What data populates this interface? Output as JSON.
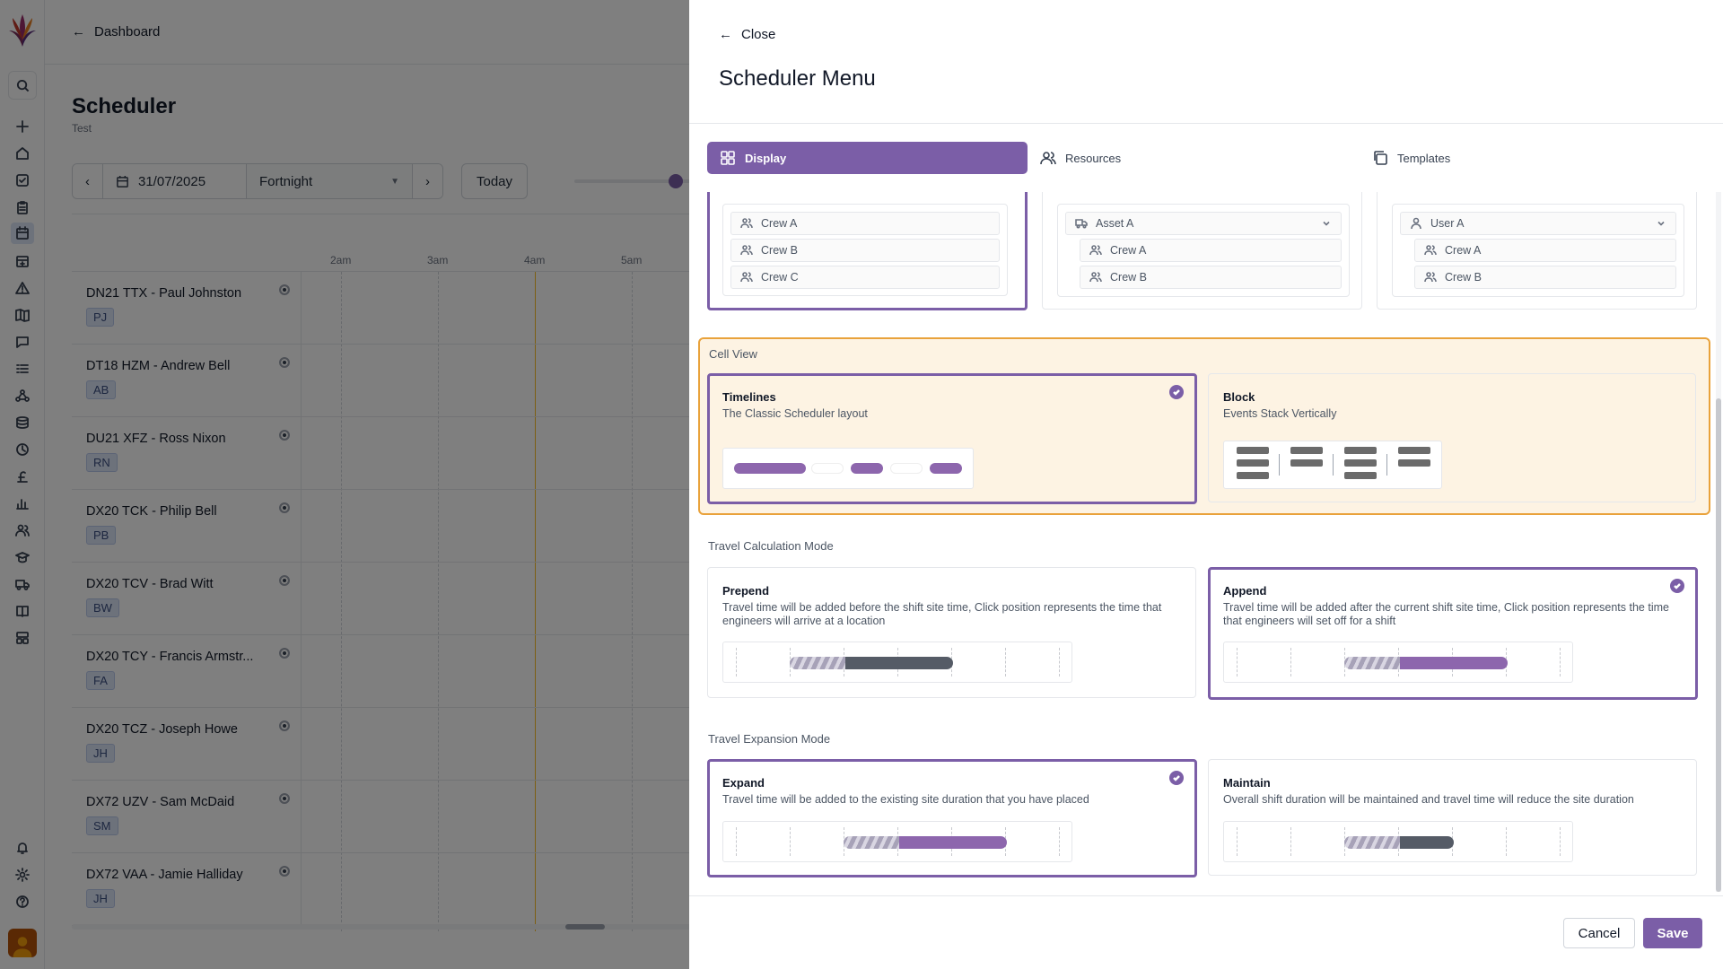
{
  "nav": {
    "icons": [
      "plus-icon",
      "home-icon",
      "check-square-icon",
      "clipboard-icon",
      "calendar-icon",
      "calendar-plus-icon",
      "alert-icon",
      "map-icon",
      "chat-icon",
      "list-icon",
      "network-icon",
      "database-icon",
      "clock-icon",
      "pound-icon",
      "bar-chart-icon",
      "users-icon",
      "graduation-icon",
      "truck-icon",
      "book-icon",
      "layout-icon"
    ],
    "bottom_icons": [
      "bell-icon",
      "gear-icon",
      "help-icon"
    ]
  },
  "background": {
    "back_label": "Dashboard",
    "page_title": "Scheduler",
    "page_subtitle": "Test",
    "date": "31/07/2025",
    "view_mode": "Fortnight",
    "today_label": "Today",
    "hours": [
      "2am",
      "3am",
      "4am",
      "5am"
    ],
    "resources": [
      {
        "name": "DN21 TTX - Paul Johnston",
        "initials": "PJ"
      },
      {
        "name": "DT18 HZM - Andrew Bell",
        "initials": "AB"
      },
      {
        "name": "DU21 XFZ - Ross Nixon",
        "initials": "RN"
      },
      {
        "name": "DX20 TCK - Philip Bell",
        "initials": "PB"
      },
      {
        "name": "DX20 TCV - Brad Witt",
        "initials": "BW"
      },
      {
        "name": "DX20 TCY - Francis Armstr...",
        "initials": "FA"
      },
      {
        "name": "DX20 TCZ - Joseph Howe",
        "initials": "JH"
      },
      {
        "name": "DX72 UZV - Sam McDaid",
        "initials": "SM"
      },
      {
        "name": "DX72 VAA - Jamie Halliday",
        "initials": "JH"
      }
    ]
  },
  "drawer": {
    "close_label": "Close",
    "title": "Scheduler Menu",
    "tabs": [
      {
        "label": "Display",
        "active": true
      },
      {
        "label": "Resources",
        "active": false
      },
      {
        "label": "Templates",
        "active": false
      }
    ],
    "group_previews": {
      "col1": [
        "Crew A",
        "Crew B",
        "Crew C"
      ],
      "col2_header": "Asset A",
      "col2": [
        "Crew A",
        "Crew B"
      ],
      "col3_header": "User A",
      "col3": [
        "Crew A",
        "Crew B"
      ]
    },
    "cell_view": {
      "title": "Cell View",
      "options": [
        {
          "title": "Timelines",
          "desc": "The Classic Scheduler layout",
          "selected": true
        },
        {
          "title": "Block",
          "desc": "Events Stack Vertically",
          "selected": false
        }
      ]
    },
    "travel_calc": {
      "title": "Travel Calculation Mode",
      "options": [
        {
          "title": "Prepend",
          "desc": "Travel time will be added before the shift site time, Click position represents the time that engineers will arrive at a location",
          "selected": false
        },
        {
          "title": "Append",
          "desc": "Travel time will be added after the current shift site time, Click position represents the time that engineers will set off for a shift",
          "selected": true
        }
      ]
    },
    "travel_expansion": {
      "title": "Travel Expansion Mode",
      "options": [
        {
          "title": "Expand",
          "desc": "Travel time will be added to the existing site duration that you have placed",
          "selected": true
        },
        {
          "title": "Maintain",
          "desc": "Overall shift duration will be maintained and travel time will reduce the site duration",
          "selected": false
        }
      ]
    },
    "cancel_label": "Cancel",
    "save_label": "Save"
  },
  "colors": {
    "accent": "#7b5ea7",
    "highlight_border": "#e9a23b",
    "highlight_bg": "#fdf3e3",
    "travel_solid_dark": "#555b66"
  }
}
